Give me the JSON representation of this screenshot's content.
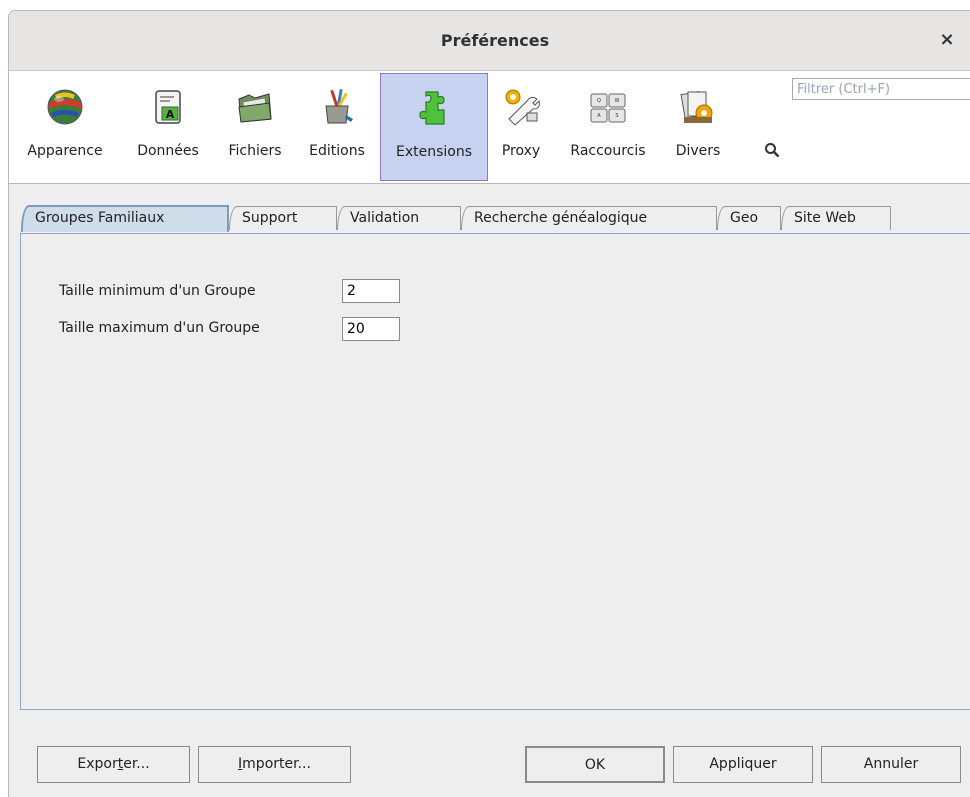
{
  "window": {
    "title": "Préférences",
    "close_glyph": "×"
  },
  "toolbar": {
    "items": [
      {
        "label": "Apparence",
        "icon": "globe-icon"
      },
      {
        "label": "Données",
        "icon": "document-a-icon"
      },
      {
        "label": "Fichiers",
        "icon": "folder-icon"
      },
      {
        "label": "Editions",
        "icon": "brushes-pot-icon"
      },
      {
        "label": "Extensions",
        "icon": "puzzle-piece-icon",
        "selected": true
      },
      {
        "label": "Proxy",
        "icon": "gears-wrench-icon"
      },
      {
        "label": "Raccourcis",
        "icon": "keyboard-keys-icon"
      },
      {
        "label": "Divers",
        "icon": "documents-gear-icon"
      }
    ],
    "filter_placeholder": "Filtrer (Ctrl+F)",
    "filter_value": ""
  },
  "tabs": [
    {
      "label": "Groupes Familiaux",
      "active": true
    },
    {
      "label": "Support"
    },
    {
      "label": "Validation"
    },
    {
      "label": "Recherche généalogique"
    },
    {
      "label": "Geo"
    },
    {
      "label": "Site Web"
    }
  ],
  "form": {
    "min_label": "Taille minimum d'un Groupe",
    "min_value": "2",
    "max_label": "Taille maximum d'un Groupe",
    "max_value": "20"
  },
  "buttons": {
    "export_pre": "Expor",
    "export_mn": "t",
    "export_post": "er...",
    "import_mn": "I",
    "import_post": "mporter...",
    "ok": "OK",
    "apply": "Appliquer",
    "cancel": "Annuler"
  },
  "colors": {
    "selected_bg": "#c7d2f0",
    "active_tab": "#cfdcea",
    "panel_border": "#8fa8c8"
  }
}
